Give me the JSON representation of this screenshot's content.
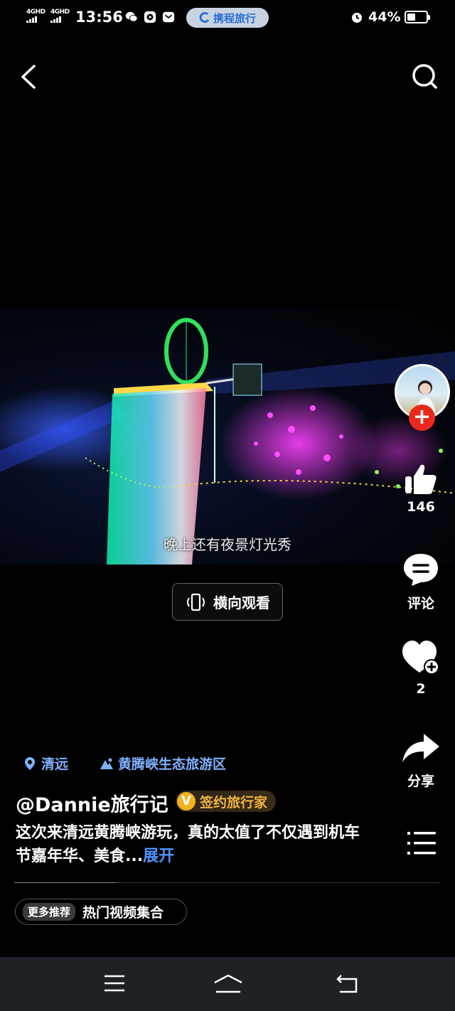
{
  "status_bar": {
    "network_1": "4GHD",
    "network_2": "4GHD",
    "time": "13:56",
    "ctrip_label": "携程旅行",
    "battery_text": "44%",
    "battery_level": 0.44
  },
  "video": {
    "subtitle": "晚上还有夜景灯光秀",
    "landscape_label": "横向观看"
  },
  "actions": {
    "follow_symbol": "+",
    "like_count": "146",
    "comment_label": "评论",
    "favorite_count": "2",
    "share_label": "分享"
  },
  "info": {
    "location": "清远",
    "poi": "黄腾峡生态旅游区",
    "author": "@Dannie旅行记",
    "badge_letter": "V",
    "badge_label": "签约旅行家",
    "description": "这次来清远黄腾峡游玩，真的太值了不仅遇到机车节嘉年华、美食...",
    "expand_label": "展开",
    "progress": 0.24,
    "more_tag": "更多推荐",
    "more_label": "热门视频集合"
  },
  "icons": {
    "back": "chevron-left-icon",
    "search": "search-icon",
    "like": "thumbs-up-icon",
    "comment": "comment-bubble-icon",
    "favorite": "heart-plus-icon",
    "share": "share-arrow-icon",
    "list": "list-icon",
    "menu": "menu-icon",
    "home": "home-icon",
    "return": "return-icon"
  },
  "colors": {
    "accent_blue": "#4f95ff",
    "follow_red": "#e8291c",
    "badge_gold": "#f2b21c"
  }
}
